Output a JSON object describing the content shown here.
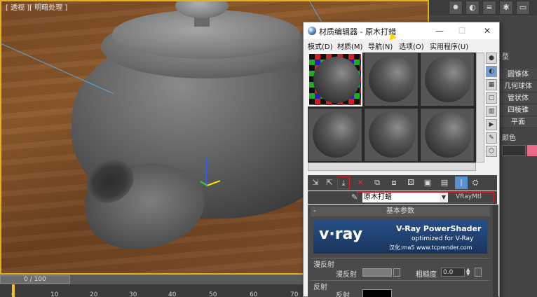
{
  "viewport": {
    "label": "[ 透视 ][ 明暗处理 ]"
  },
  "timeline": {
    "slider_text": "0 / 100",
    "ticks": [
      "0",
      "10",
      "20",
      "30",
      "40",
      "50",
      "60",
      "70"
    ]
  },
  "material_editor": {
    "title": "材质编辑器 - 原木打蜡",
    "window_buttons": {
      "minimize": "—",
      "maximize": "☐",
      "close": "✕"
    },
    "menu": [
      "模式(D)",
      "材质(M)",
      "导航(N)",
      "选项(O)",
      "实用程序(U)"
    ],
    "material_name": "原木打蜡",
    "material_type": "VRayMtl",
    "rollout_title": "基本参数",
    "vray_banner": {
      "logo": "v·ray",
      "title": "V-Ray PowerShader",
      "subtitle": "optimized for V-Ray",
      "credit": "汉化:ma5 www.tcprender.com"
    },
    "diffuse": {
      "group_label": "漫反射",
      "label": "漫反射",
      "roughness_label": "粗糙度",
      "roughness_value": "0.0"
    },
    "reflection": {
      "group_label": "反射",
      "label": "反射"
    }
  },
  "command_panel": {
    "header": "型",
    "rows": [
      "圆锥体",
      "几何球体",
      "管状体",
      "四棱锥",
      "平面"
    ],
    "color_label": "颜色"
  },
  "colors": {
    "viewport_border": "#e2b11a",
    "highlight": "#e02020",
    "object_color": "#ea6a8b"
  }
}
